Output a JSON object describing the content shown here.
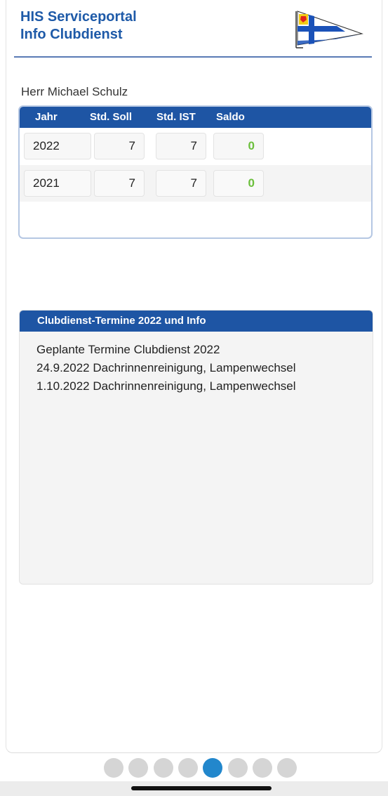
{
  "header": {
    "title_line1": "HIS Serviceportal",
    "title_line2": "Info Clubdienst",
    "logo_icon": "club-burgee-flag-icon",
    "colors": {
      "title": "#1e5aa8",
      "underline": "#5a7bb5"
    }
  },
  "member": {
    "name": "Herr Michael Schulz"
  },
  "hours_table": {
    "columns": [
      "Jahr",
      "Std. Soll",
      "Std. IST",
      "Saldo"
    ],
    "rows": [
      {
        "year": "2022",
        "soll": "7",
        "ist": "7",
        "saldo": "0"
      },
      {
        "year": "2021",
        "soll": "7",
        "ist": "7",
        "saldo": "0"
      }
    ],
    "colors": {
      "header_bg": "#1e55a4",
      "saldo_text": "#6bbf3c"
    }
  },
  "info_panel": {
    "title": "Clubdienst-Termine 2022 und Info",
    "lines": [
      "Geplante Termine Clubdienst 2022",
      "24.9.2022 Dachrinnenreinigung, Lampenwechsel",
      "1.10.2022 Dachrinnenreinigung, Lampenwechsel"
    ]
  },
  "pager": {
    "total": 8,
    "active_index": 4,
    "colors": {
      "active": "#2287cc",
      "inactive": "#d5d5d5"
    }
  }
}
